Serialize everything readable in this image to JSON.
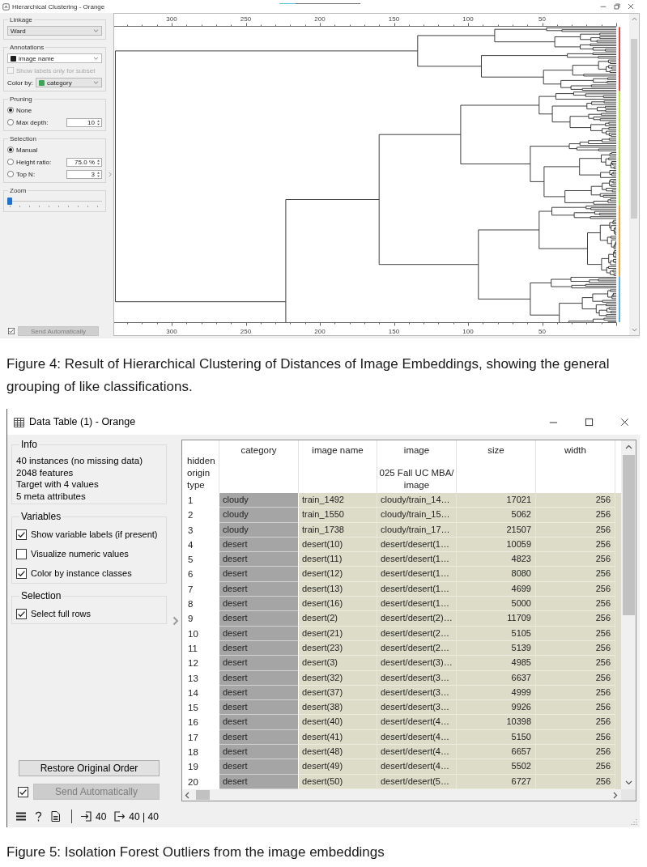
{
  "figure_4": {
    "window": {
      "title": "Hierarchical Clustering - Orange",
      "progress": {
        "level": 0.2
      }
    },
    "linkage": {
      "title": "Linkage",
      "value": "Ward"
    },
    "annotations": {
      "title": "Annotations",
      "value": "image name",
      "subset_labels": {
        "label": "Show labels only for subset",
        "checked": false,
        "disabled": true
      },
      "color_by": {
        "label": "Color by:",
        "value": "category"
      }
    },
    "pruning": {
      "title": "Pruning",
      "options": [
        {
          "label": "None",
          "selected": true
        },
        {
          "label": "Max depth:",
          "selected": false,
          "spin": "10"
        }
      ]
    },
    "selection": {
      "title": "Selection",
      "options": [
        {
          "label": "Manual",
          "selected": true
        },
        {
          "label": "Height ratio:",
          "selected": false,
          "spin": "75.0 %"
        },
        {
          "label": "Top N:",
          "selected": false,
          "spin": "3"
        }
      ]
    },
    "zoom": {
      "title": "Zoom",
      "level": 0
    },
    "send": {
      "label": "Send Automatically",
      "checked": true,
      "disabled": true
    },
    "axis_top": {
      "ticks": [
        "300",
        "250",
        "200",
        "150",
        "100",
        "50"
      ]
    },
    "axis_bottom": {
      "ticks": [
        "300",
        "250",
        "200",
        "150",
        "100",
        "50"
      ]
    }
  },
  "caption_4": "Figure 4: Result of Hierarchical Clustering of Distances of Image Embeddings, showing the general grouping of like classifications.",
  "figure_5": {
    "window": {
      "title": "Data Table (1) - Orange"
    },
    "info": {
      "title": "Info",
      "lines": [
        "40 instances (no missing data)",
        "2048 features",
        "Target with 4 values",
        "5 meta attributes"
      ]
    },
    "variables": {
      "title": "Variables",
      "options": [
        {
          "label": "Show variable labels (if present)",
          "checked": true
        },
        {
          "label": "Visualize numeric values",
          "checked": false
        },
        {
          "label": "Color by instance classes",
          "checked": true
        }
      ]
    },
    "selection": {
      "title": "Selection",
      "options": [
        {
          "label": "Select full rows",
          "checked": true
        }
      ]
    },
    "restore_button": {
      "label": "Restore Original Order"
    },
    "send": {
      "label": "Send Automatically",
      "checked": true,
      "disabled": true
    },
    "table": {
      "label_keys": [
        "hidden",
        "origin",
        "type"
      ],
      "columns": [
        {
          "name": "category",
          "kind": "class"
        },
        {
          "name": "image name",
          "kind": "text"
        },
        {
          "name": "image",
          "kind": "text",
          "sublabels": [
            "025 Fall UC MBA/",
            "image"
          ]
        },
        {
          "name": "size",
          "kind": "numeric"
        },
        {
          "name": "width",
          "kind": "numeric"
        }
      ],
      "rows": [
        {
          "index": "1",
          "cells": [
            "cloudy",
            "train_1492",
            "cloudy/train_14…",
            "17021",
            "256"
          ],
          "selected": true
        },
        {
          "index": "2",
          "cells": [
            "cloudy",
            "train_1550",
            "cloudy/train_15…",
            "5062",
            "256"
          ],
          "selected": true
        },
        {
          "index": "3",
          "cells": [
            "cloudy",
            "train_1738",
            "cloudy/train_17…",
            "21507",
            "256"
          ],
          "selected": true
        },
        {
          "index": "4",
          "cells": [
            "desert",
            "desert(10)",
            "desert/desert(1…",
            "10059",
            "256"
          ],
          "selected": true
        },
        {
          "index": "5",
          "cells": [
            "desert",
            "desert(11)",
            "desert/desert(1…",
            "4823",
            "256"
          ],
          "selected": true
        },
        {
          "index": "6",
          "cells": [
            "desert",
            "desert(12)",
            "desert/desert(1…",
            "8080",
            "256"
          ],
          "selected": true
        },
        {
          "index": "7",
          "cells": [
            "desert",
            "desert(13)",
            "desert/desert(1…",
            "4699",
            "256"
          ],
          "selected": true
        },
        {
          "index": "8",
          "cells": [
            "desert",
            "desert(16)",
            "desert/desert(1…",
            "5000",
            "256"
          ],
          "selected": true
        },
        {
          "index": "9",
          "cells": [
            "desert",
            "desert(2)",
            "desert/desert(2)…",
            "11709",
            "256"
          ],
          "selected": true
        },
        {
          "index": "10",
          "cells": [
            "desert",
            "desert(21)",
            "desert/desert(2…",
            "5105",
            "256"
          ],
          "selected": true
        },
        {
          "index": "11",
          "cells": [
            "desert",
            "desert(23)",
            "desert/desert(2…",
            "5139",
            "256"
          ],
          "selected": true
        },
        {
          "index": "12",
          "cells": [
            "desert",
            "desert(3)",
            "desert/desert(3)…",
            "4985",
            "256"
          ],
          "selected": true
        },
        {
          "index": "13",
          "cells": [
            "desert",
            "desert(32)",
            "desert/desert(3…",
            "6637",
            "256"
          ],
          "selected": true
        },
        {
          "index": "14",
          "cells": [
            "desert",
            "desert(37)",
            "desert/desert(3…",
            "4999",
            "256"
          ],
          "selected": true
        },
        {
          "index": "15",
          "cells": [
            "desert",
            "desert(38)",
            "desert/desert(3…",
            "9926",
            "256"
          ],
          "selected": true
        },
        {
          "index": "16",
          "cells": [
            "desert",
            "desert(40)",
            "desert/desert(4…",
            "10398",
            "256"
          ],
          "selected": true
        },
        {
          "index": "17",
          "cells": [
            "desert",
            "desert(41)",
            "desert/desert(4…",
            "5150",
            "256"
          ],
          "selected": true
        },
        {
          "index": "18",
          "cells": [
            "desert",
            "desert(48)",
            "desert/desert(4…",
            "6657",
            "256"
          ],
          "selected": true
        },
        {
          "index": "19",
          "cells": [
            "desert",
            "desert(49)",
            "desert/desert(4…",
            "5502",
            "256"
          ],
          "selected": true
        },
        {
          "index": "20",
          "cells": [
            "desert",
            "desert(50)",
            "desert/desert(5…",
            "6727",
            "256"
          ],
          "selected": true
        }
      ]
    },
    "status_bar": {
      "input_count": "40",
      "output_count": "40 | 40"
    }
  },
  "caption_5": "Figure 5: Isolation Forest Outliers from the image embeddings"
}
